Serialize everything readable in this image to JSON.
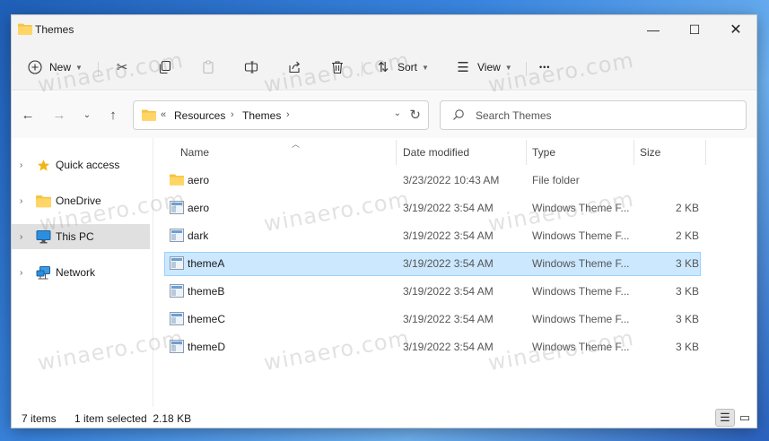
{
  "window": {
    "title": "Themes",
    "minimize_glyph": "—",
    "maximize_glyph": "☐",
    "close_glyph": "✕"
  },
  "toolbar": {
    "new_label": "New",
    "sort_label": "Sort",
    "view_label": "View",
    "more_glyph": "•••"
  },
  "address": {
    "overflow_glyph": "«",
    "parts": [
      "Resources",
      "Themes"
    ]
  },
  "search": {
    "placeholder": "Search Themes"
  },
  "navigation": {
    "items": [
      {
        "label": "Quick access",
        "icon": "star-icon",
        "selected": false
      },
      {
        "label": "OneDrive",
        "icon": "folder-icon",
        "selected": false
      },
      {
        "label": "This PC",
        "icon": "monitor-icon",
        "selected": true
      },
      {
        "label": "Network",
        "icon": "network-icon",
        "selected": false
      }
    ]
  },
  "columns": {
    "name": "Name",
    "date": "Date modified",
    "type": "Type",
    "size": "Size"
  },
  "files": [
    {
      "name": "aero",
      "date": "3/23/2022 10:43 AM",
      "type": "File folder",
      "size": "",
      "icon": "folder-icon",
      "selected": false
    },
    {
      "name": "aero",
      "date": "3/19/2022 3:54 AM",
      "type": "Windows Theme F...",
      "size": "2 KB",
      "icon": "theme-file-icon",
      "selected": false
    },
    {
      "name": "dark",
      "date": "3/19/2022 3:54 AM",
      "type": "Windows Theme F...",
      "size": "2 KB",
      "icon": "theme-file-icon",
      "selected": false
    },
    {
      "name": "themeA",
      "date": "3/19/2022 3:54 AM",
      "type": "Windows Theme F...",
      "size": "3 KB",
      "icon": "theme-file-icon",
      "selected": true
    },
    {
      "name": "themeB",
      "date": "3/19/2022 3:54 AM",
      "type": "Windows Theme F...",
      "size": "3 KB",
      "icon": "theme-file-icon",
      "selected": false
    },
    {
      "name": "themeC",
      "date": "3/19/2022 3:54 AM",
      "type": "Windows Theme F...",
      "size": "3 KB",
      "icon": "theme-file-icon",
      "selected": false
    },
    {
      "name": "themeD",
      "date": "3/19/2022 3:54 AM",
      "type": "Windows Theme F...",
      "size": "3 KB",
      "icon": "theme-file-icon",
      "selected": false
    }
  ],
  "status": {
    "items_count": "7 items",
    "selection": "1 item selected  2.18 KB"
  },
  "watermark": "winaero.com",
  "colors": {
    "selection_bg": "#cce8ff",
    "selection_border": "#99d1ff",
    "folder": "#f5c342",
    "accent": "#0067c0"
  }
}
